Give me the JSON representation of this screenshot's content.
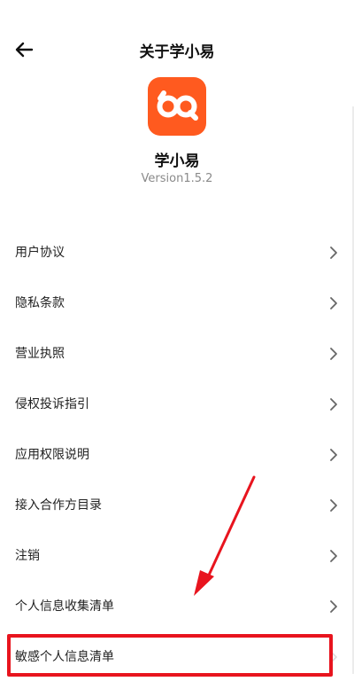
{
  "header": {
    "title": "关于学小易",
    "back_icon": "arrow-left-icon"
  },
  "app": {
    "name": "学小易",
    "version": "Version1.5.2",
    "logo_color": "#ff5a1f"
  },
  "menu": {
    "items": [
      {
        "label": "用户协议"
      },
      {
        "label": "隐私条款"
      },
      {
        "label": "营业执照"
      },
      {
        "label": "侵权投诉指引"
      },
      {
        "label": "应用权限说明"
      },
      {
        "label": "接入合作方目录"
      },
      {
        "label": "注销"
      },
      {
        "label": "个人信息收集清单"
      },
      {
        "label": "敏感个人信息清单"
      }
    ]
  },
  "annotation": {
    "color": "#e8141e"
  }
}
